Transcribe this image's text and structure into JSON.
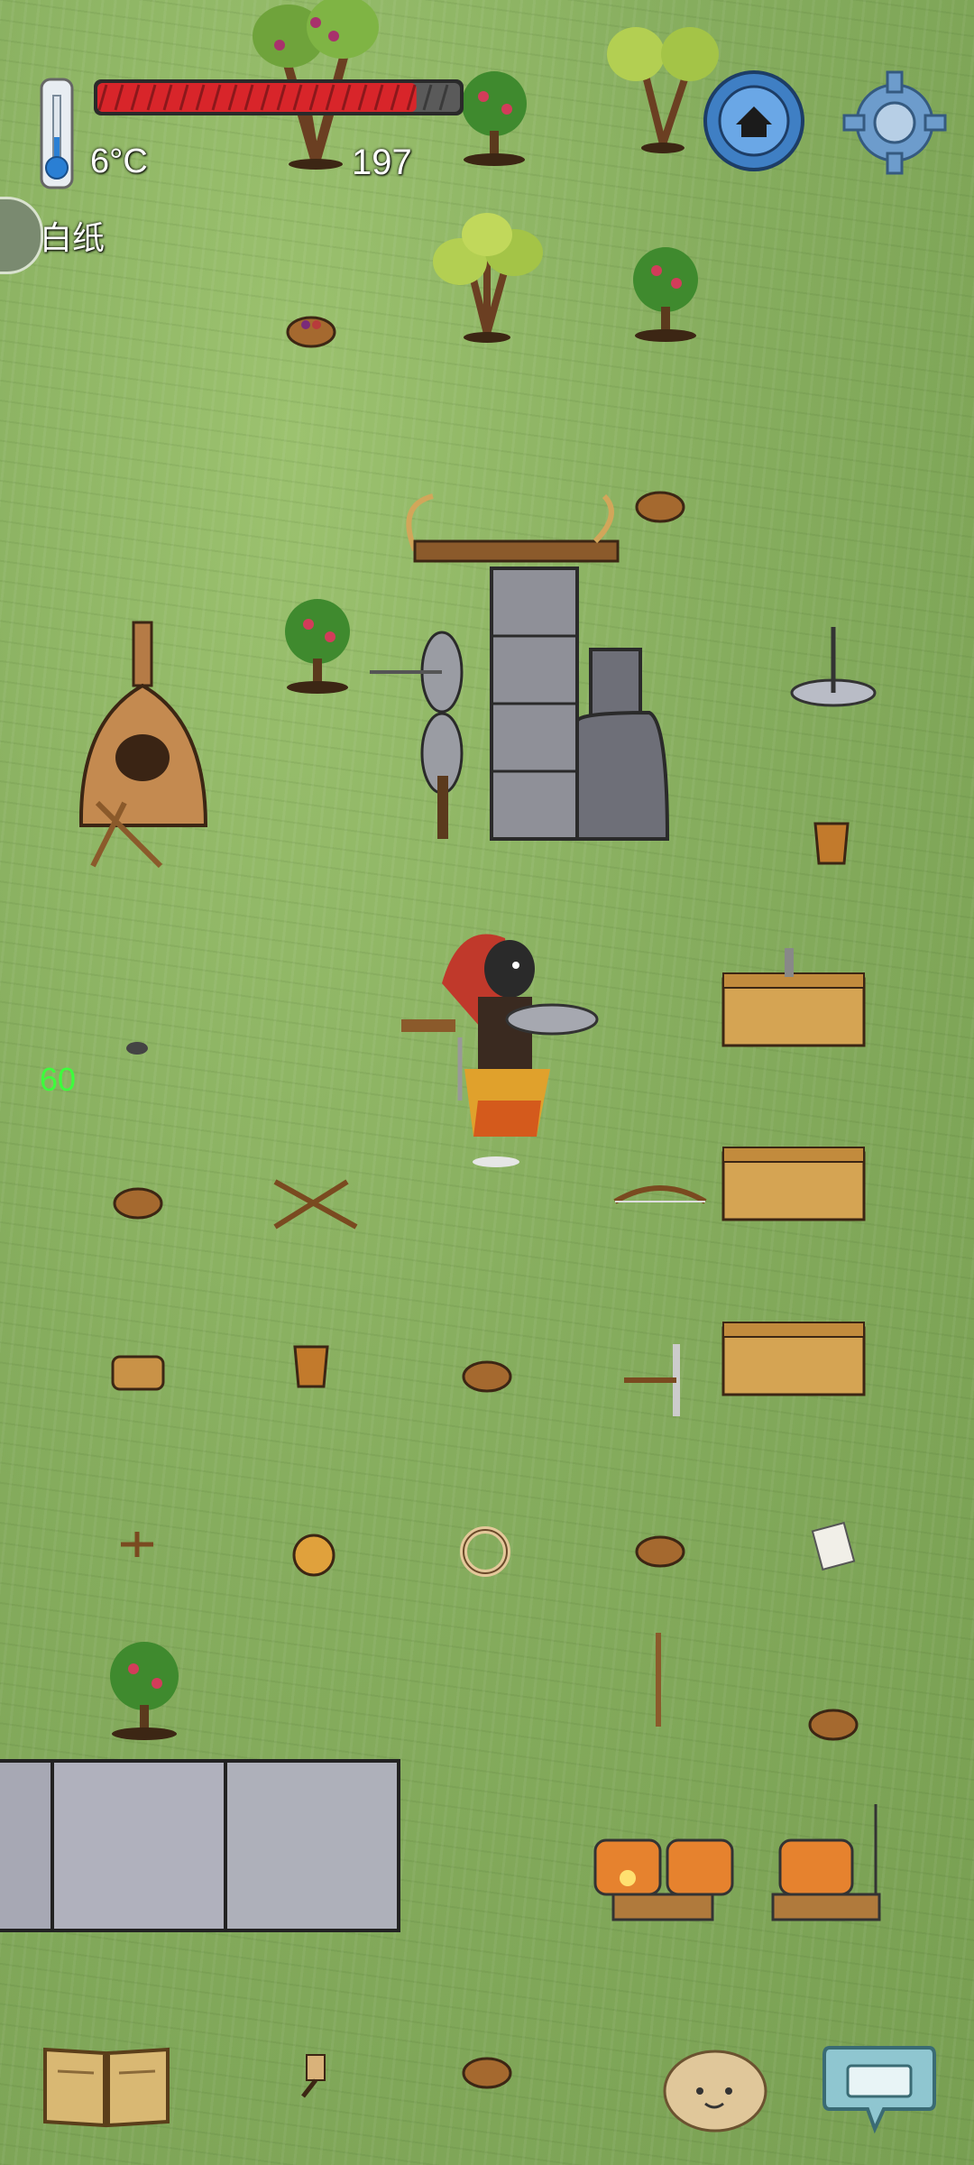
{
  "hud": {
    "temperature": "6°C",
    "health_fraction": 0.88,
    "count": "197",
    "player_name": "白纸",
    "fps": "60"
  },
  "buttons": {
    "home_icon": "home-icon",
    "settings_icon": "gear-icon",
    "book_icon": "recipe-book-icon",
    "emote_icon": "emote-face-icon",
    "keyboard_icon": "keyboard-chat-icon"
  },
  "colors": {
    "grass": "#86ad5e",
    "health_red": "#d8252a",
    "health_empty": "#5a5a5a",
    "home_blue": "#3f7fc4",
    "fps_green": "#3cff3c"
  }
}
